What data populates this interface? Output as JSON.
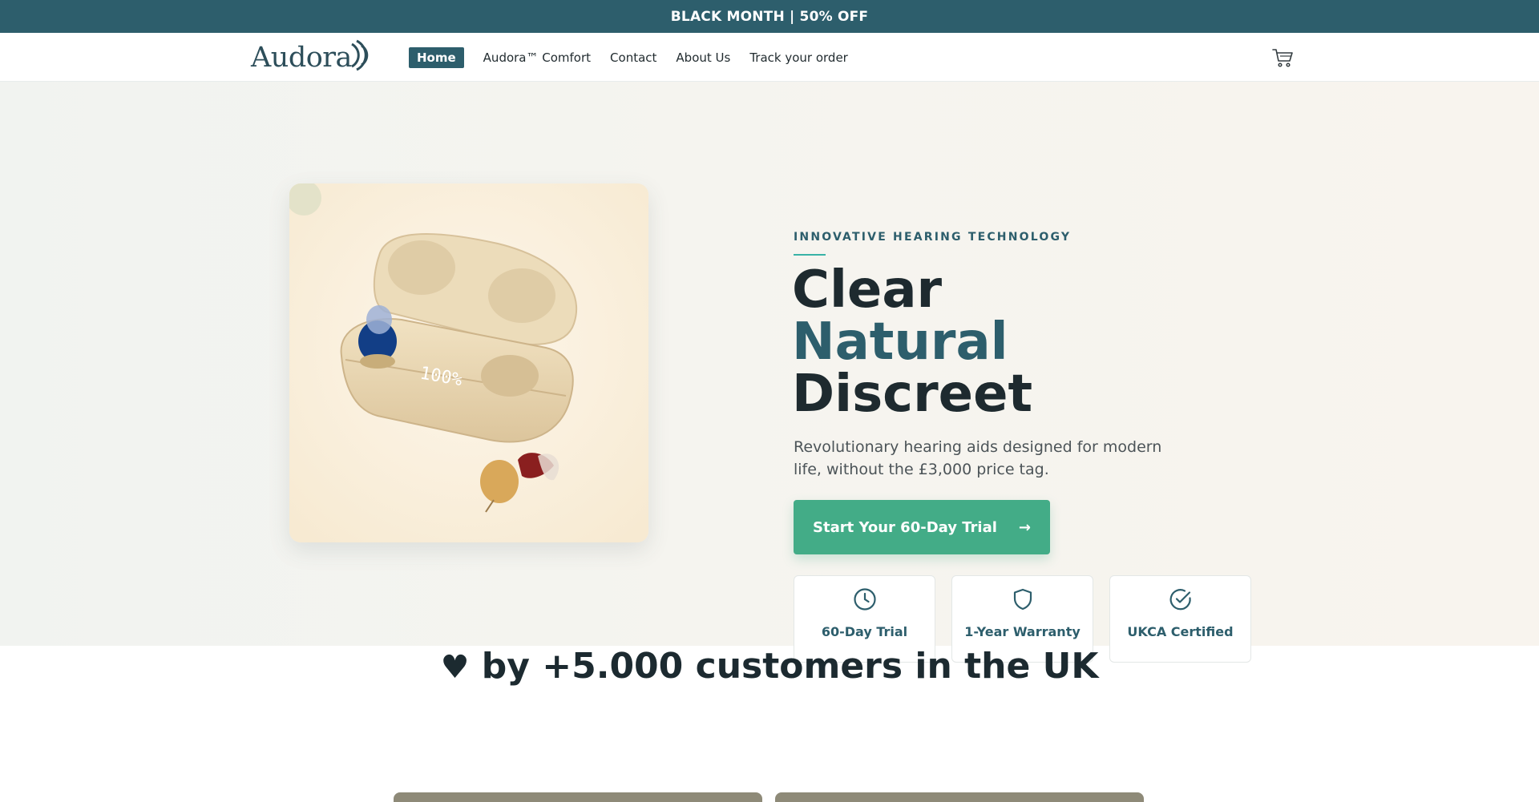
{
  "announcement": {
    "text": "BLACK MONTH | 50% OFF"
  },
  "header": {
    "logo_text": "Audora",
    "nav": [
      {
        "label": "Home",
        "active": true
      },
      {
        "label": "Audora™ Comfort",
        "active": false
      },
      {
        "label": "Contact",
        "active": false
      },
      {
        "label": "About Us",
        "active": false
      },
      {
        "label": "Track your order",
        "active": false
      }
    ],
    "cart_icon": "cart-icon"
  },
  "hero": {
    "eyebrow": "INNOVATIVE HEARING TECHNOLOGY",
    "headline": {
      "line1": "Clear",
      "line2": "Natural",
      "line3": "Discreet"
    },
    "subtitle": "Revolutionary hearing aids designed for modern life, without the £3,000 price tag.",
    "cta": {
      "label": "Start Your 60-Day Trial",
      "arrow": "→"
    },
    "product_display": "100%",
    "features": [
      {
        "icon": "clock-icon",
        "label": "60-Day Trial"
      },
      {
        "icon": "shield-icon",
        "label": "1-Year Warranty"
      },
      {
        "icon": "check-circle-icon",
        "label": "UKCA Certified"
      }
    ]
  },
  "social_proof": {
    "heart": "♥",
    "text": "by +5.000 customers in the UK"
  },
  "colors": {
    "brand": "#2d5e6c",
    "cta": "#43ac87",
    "accent_line": "#38b2a6",
    "hero_bg": "#f5f4ef"
  }
}
